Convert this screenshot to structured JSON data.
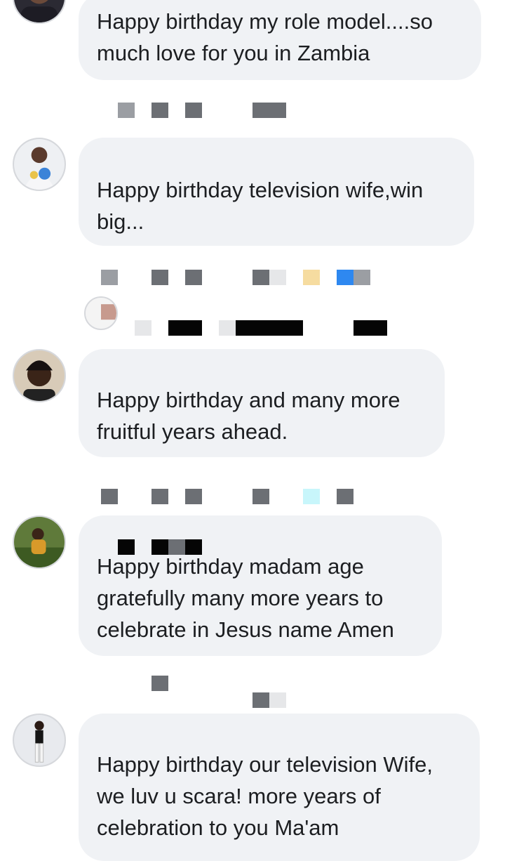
{
  "comments": [
    {
      "text": "Happy birthday my role model....so\nmuch love for you in Zambia"
    },
    {
      "text": "Happy birthday television wife,win\nbig..."
    },
    {
      "text": "Happy birthday and many more\nfruitful years ahead."
    },
    {
      "text": "Happy birthday madam age\ngratefully many more years to\ncelebrate in Jesus name Amen"
    },
    {
      "text": "Happy birthday our television Wife,\nwe luv u scara!  more years of\ncelebration to you Ma'am"
    }
  ],
  "colors": {
    "bubble_background": "#f0f2f5",
    "comment_text": "#1c1e21",
    "page_background": "#ffffff"
  }
}
